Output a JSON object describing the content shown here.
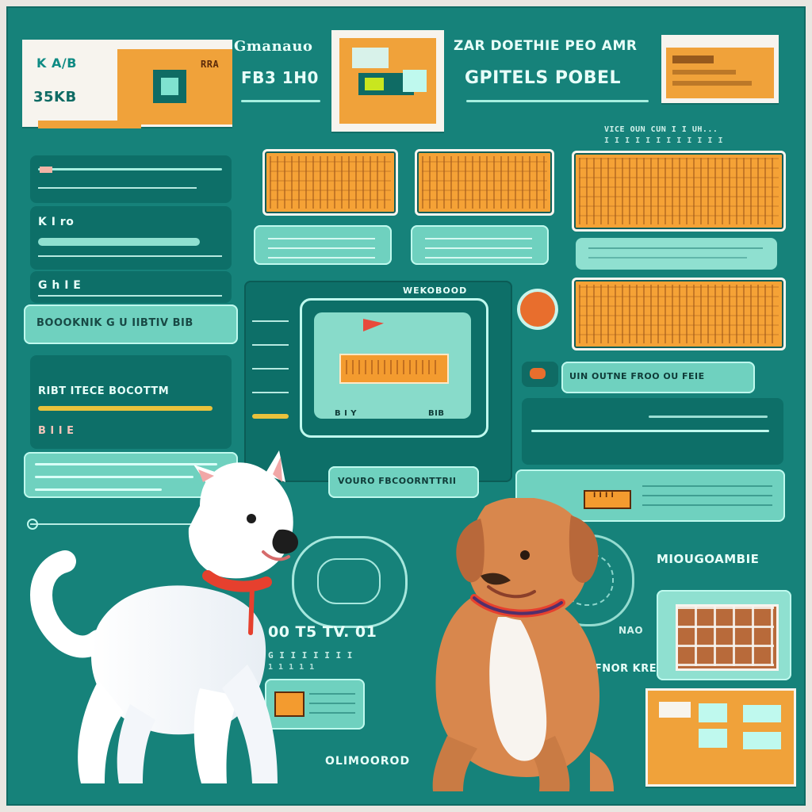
{
  "header": {
    "tile_left_text_top": "K A/B",
    "tile_left_text_bottom": "35KB",
    "tile_left_orange_label": "RRA",
    "top_title_left": "Gmanauo",
    "top_title_left_sub": "FB3 1H0",
    "top_title_right": "ZAR DOETHIE PEO AMR",
    "top_title_right_sub": "GPITELS POBEL",
    "top_right_small": "VICE OUN CUN I I UH...",
    "top_right_small2": "I I I I I I I I I I I I"
  },
  "left_column": {
    "label_1": "K I ro",
    "label_2": "G h I E",
    "button_1": "BOOOKNIK  G U IIBTIV BIB",
    "label_3": "RIBT ITECE BOCOTTM",
    "label_4": "B I I E"
  },
  "center": {
    "monitor_title": "WEKOBOOD",
    "monitor_bottom_left": "B I Y",
    "monitor_bottom_right": "BIB",
    "center_button": "VOURO FBCOORNTTRII",
    "center_footer_small": "G I I I I I I I",
    "center_footer_small2": "1 1 1 1 1",
    "center_number": "00 T5 TV. 01"
  },
  "right_column": {
    "search_bar_text": "UIN OUTNE FROO OU FEIE",
    "section_title": "MIOUGOAMBIE",
    "right_small_1": "NAO",
    "right_small_2": "O4GOFNOR KRE",
    "orange_chip": "I I I I"
  },
  "footer": {
    "bottom_center_label": "OLIMOOROD"
  },
  "colors": {
    "board": "#16827a",
    "mint": "#6fd1bf",
    "orange": "#f0a23a",
    "cream": "#f7f4ee"
  }
}
